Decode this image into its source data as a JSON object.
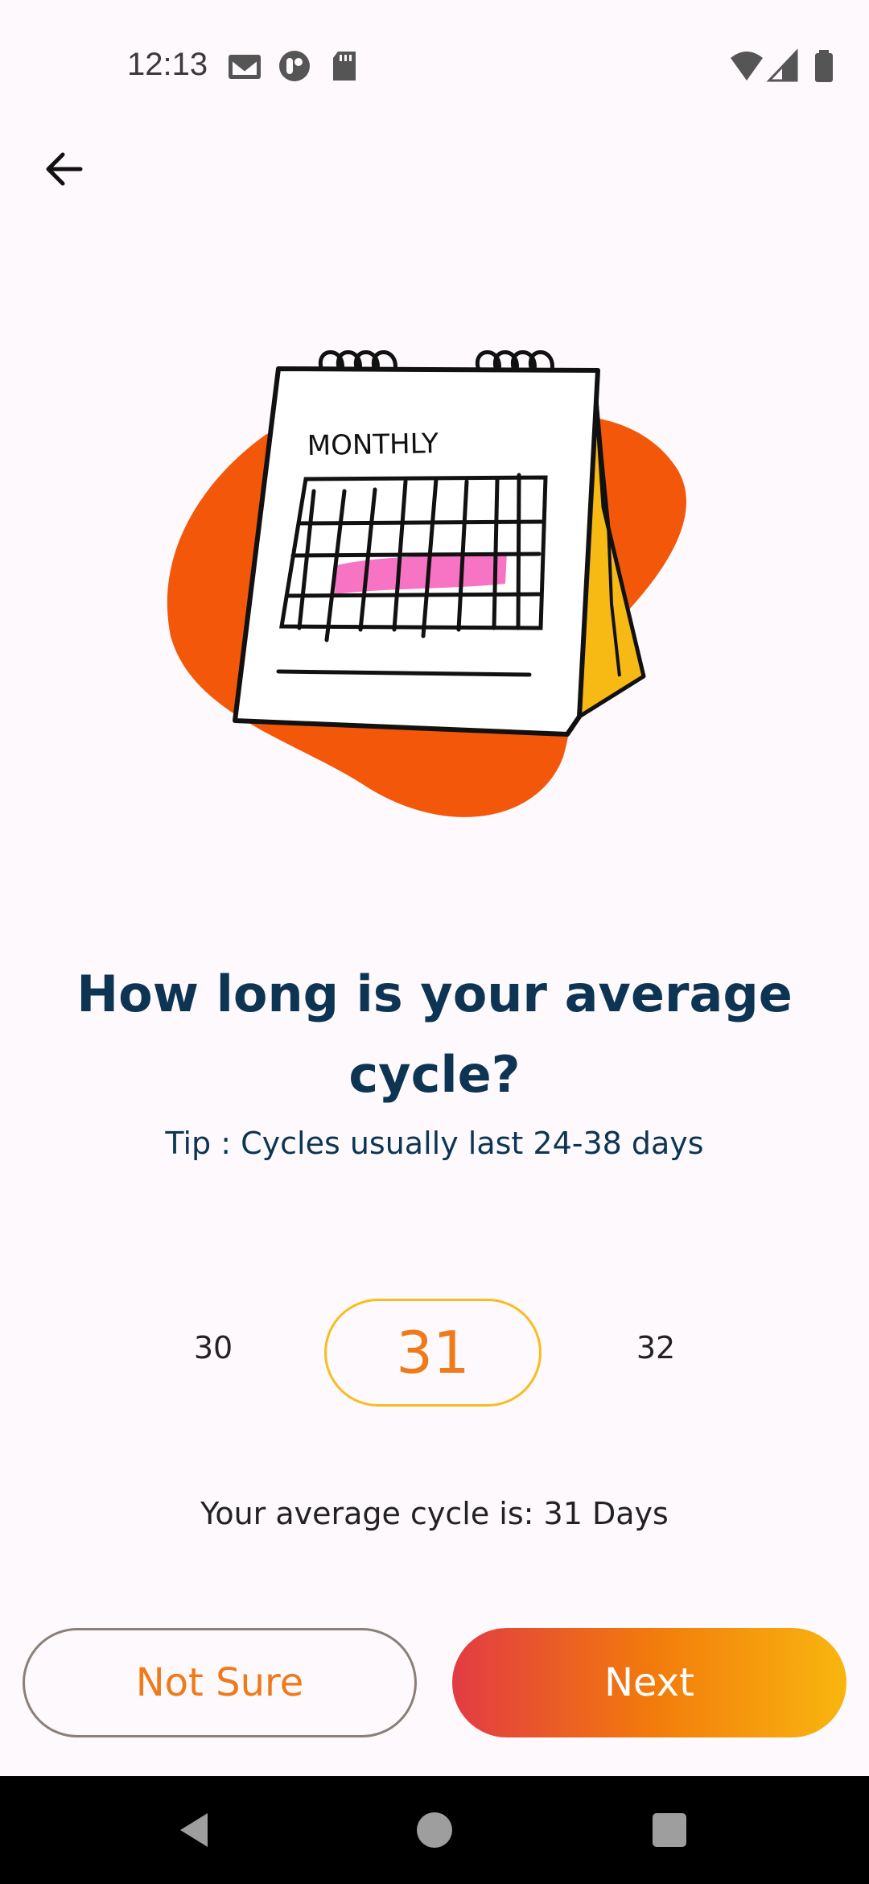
{
  "status_bar": {
    "time": "12:13",
    "left_icons": [
      "gmail-icon",
      "app-notification-icon",
      "sd-card-icon"
    ],
    "right_icons": [
      "wifi-icon",
      "cell-signal-icon",
      "battery-icon"
    ]
  },
  "header": {
    "back_icon": "arrow-left-icon"
  },
  "illustration": {
    "calendar_label": "MONTHLY",
    "blob_color": "#f2570a",
    "highlight_color": "#f774c4",
    "page_edge_color": "#f7b914"
  },
  "main": {
    "title": "How long is your average cycle?",
    "tip": "Tip : Cycles usually last 24-38 days"
  },
  "picker": {
    "prev": "30",
    "selected": "31",
    "next": "32",
    "accent_color": "#ef7a1a",
    "border_color": "#f7bd20"
  },
  "summary": "Your average cycle is: 31 Days",
  "actions": {
    "not_sure_label": "Not Sure",
    "next_label": "Next"
  },
  "nav_bar": {
    "icons": [
      "back-triangle-icon",
      "home-circle-icon",
      "recents-square-icon"
    ]
  }
}
